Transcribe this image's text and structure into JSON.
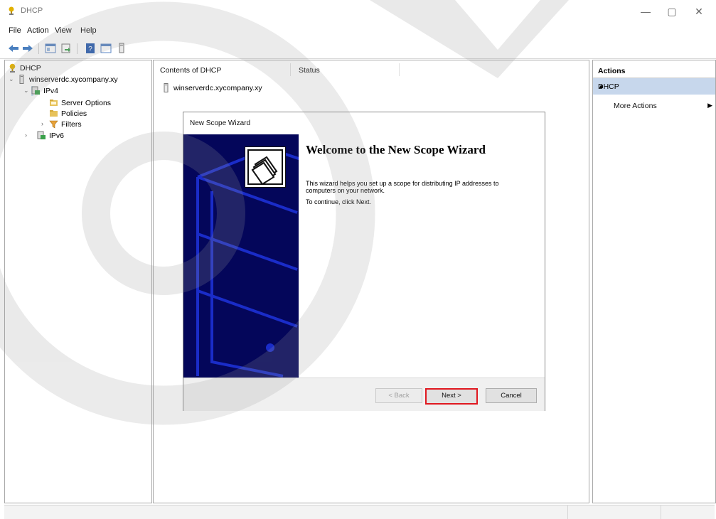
{
  "window": {
    "title": "DHCP",
    "controls": [
      "—",
      "▢",
      "✕"
    ]
  },
  "menu": [
    "File",
    "Action",
    "View",
    "Help"
  ],
  "tree": {
    "root": "DHCP",
    "server": "winserverdc.xycompany.xy",
    "ipv4": "IPv4",
    "server_options": "Server Options",
    "policies": "Policies",
    "filters": "Filters",
    "ipv6": "IPv6"
  },
  "center": {
    "columns": [
      "Contents of DHCP",
      "Status"
    ],
    "rows": [
      {
        "name": "winserverdc.xycompany.xy",
        "status": ""
      }
    ]
  },
  "actions": {
    "header": "Actions",
    "group": "DHCP",
    "more": "More Actions"
  },
  "wizard": {
    "title": "New Scope Wizard",
    "heading": "Welcome to the New Scope Wizard",
    "text1": "This wizard helps you set up a scope for distributing IP addresses to computers on your network.",
    "text2": "To continue, click Next.",
    "back": "< Back",
    "next": "Next >",
    "cancel": "Cancel"
  },
  "colors": {
    "banner": "#04065a",
    "selection": "#c7d7ec",
    "highlight": "#e01820"
  },
  "icons": [
    "dhcp-icon",
    "back-arrow-icon",
    "forward-arrow-icon",
    "console-icon",
    "export-icon",
    "help-icon",
    "server-icon",
    "ipv4-icon",
    "folder-icon",
    "filter-icon",
    "ipv6-icon",
    "wizard-folders-icon"
  ]
}
